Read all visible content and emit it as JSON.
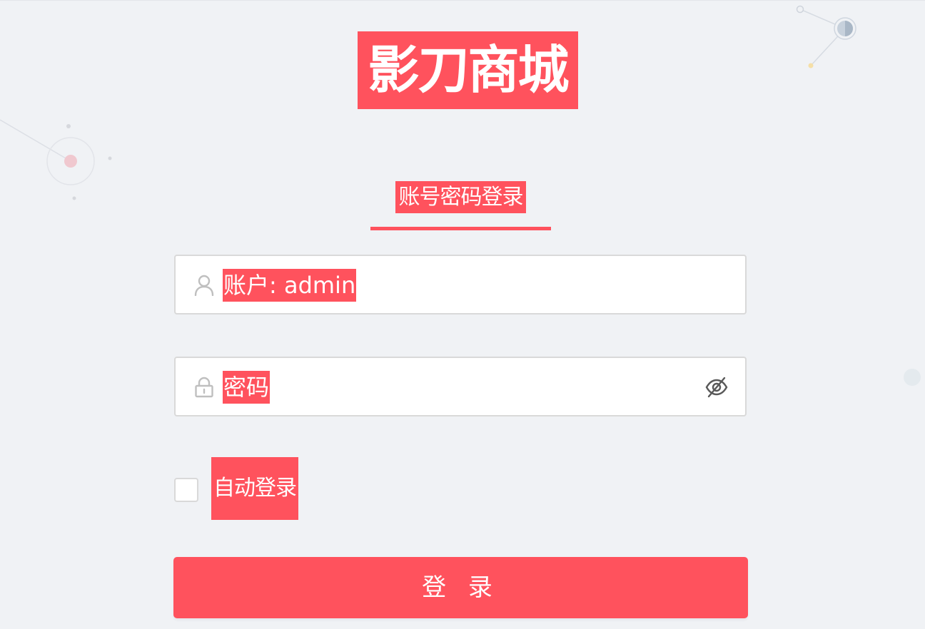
{
  "app": {
    "brand_title": "影刀商城"
  },
  "login": {
    "tab_label": "账号密码登录",
    "username_value": "账户: admin",
    "password_placeholder": "密码",
    "auto_login_label": "自动登录",
    "auto_login_checked": false,
    "submit_label": "登 录"
  },
  "icons": {
    "username": "user-icon",
    "password": "lock-icon",
    "visibility": "eye-off-icon"
  },
  "colors": {
    "accent": "#ff525d",
    "background": "#f0f2f5",
    "field_border": "#d9d9d9",
    "icon_gray": "#bfbfbf"
  }
}
